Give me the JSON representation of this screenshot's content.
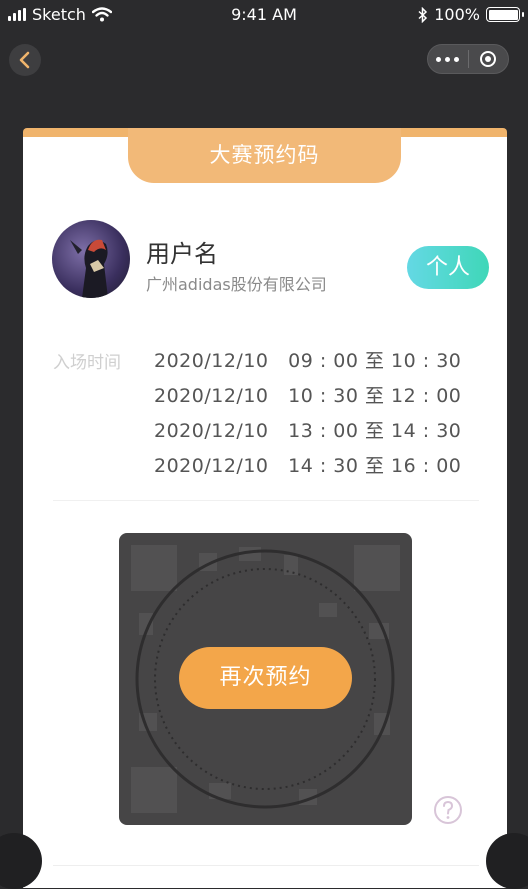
{
  "status_bar": {
    "carrier": "Sketch",
    "time": "9:41 AM",
    "battery": "100%",
    "battery_level": 1.0
  },
  "nav": {
    "back_icon": "chevron-left-icon",
    "capsule_icons": [
      "more-dots-icon",
      "target-icon"
    ]
  },
  "card": {
    "title": "大赛预约码",
    "user_name": "用户名",
    "company": "广州adidas股份有限公司",
    "type_badge": "个人",
    "entry_label": "入场时间",
    "time_slots": [
      "2020/12/10   09 : 00 至 10 : 30",
      "2020/12/10   10 : 30 至 12 : 00",
      "2020/12/10   13 : 00 至 14 : 30",
      "2020/12/10   14 : 30 至 16 : 00"
    ],
    "rebook_label": "再次预约",
    "help_icon": "question-circle-icon"
  },
  "colors": {
    "accent_orange": "#f2b978",
    "button_orange": "#f3a64a",
    "badge_teal": "#4fd8cc",
    "background": "#2b2b2d"
  }
}
